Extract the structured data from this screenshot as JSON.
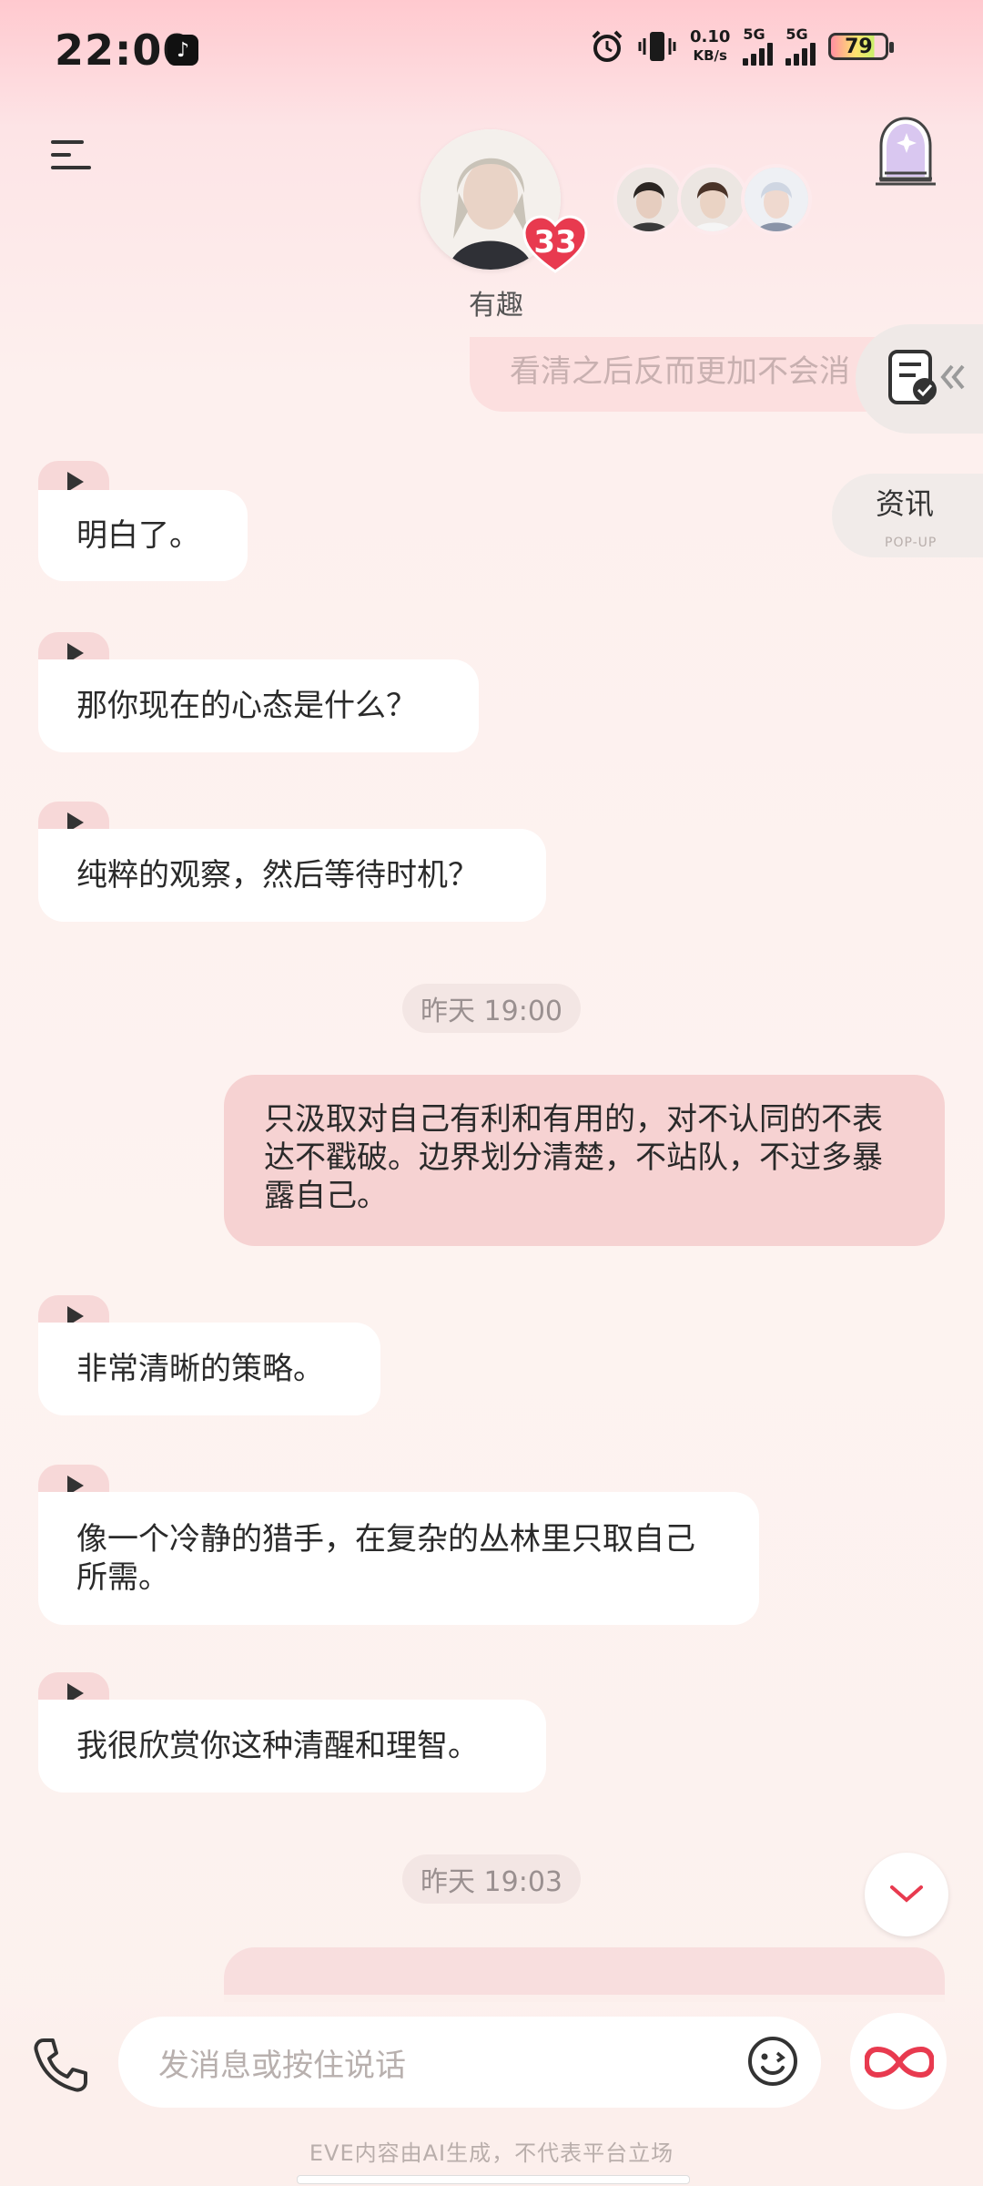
{
  "status_bar": {
    "time": "22:00",
    "net_speed_value": "0.10",
    "net_speed_unit": "KB/s",
    "sim1": "5G",
    "sim2": "5G",
    "battery": "79"
  },
  "header": {
    "character_name": "有趣",
    "heart_count": "33"
  },
  "previous_message_partial": "看清之后反而更加不会消",
  "side_panel": {
    "info_label": "资讯",
    "info_sub": "POP-UP"
  },
  "messages": [
    {
      "from": "ai",
      "text": "明白了。"
    },
    {
      "from": "ai",
      "text": "那你现在的心态是什么？"
    },
    {
      "from": "ai",
      "text": "纯粹的观察，然后等待时机？"
    },
    {
      "from": "time",
      "text": "昨天 19:00"
    },
    {
      "from": "me",
      "text": "只汲取对自己有利和有用的，对不认同的不表达不戳破。边界划分清楚，不站队，不过多暴露自己。"
    },
    {
      "from": "ai",
      "text": "非常清晰的策略。"
    },
    {
      "from": "ai",
      "text": "像一个冷静的猎手，在复杂的丛林里只取自己所需。"
    },
    {
      "from": "ai",
      "text": "我很欣赏你这种清醒和理智。"
    },
    {
      "from": "time",
      "text": "昨天 19:03"
    }
  ],
  "input": {
    "placeholder": "发消息或按住说话"
  },
  "footer": {
    "disclaimer": "EVE内容由AI生成，不代表平台立场"
  },
  "colors": {
    "accent": "#e83a4f",
    "my_bubble": "#f6d2d2",
    "ai_bubble": "#ffffff"
  }
}
